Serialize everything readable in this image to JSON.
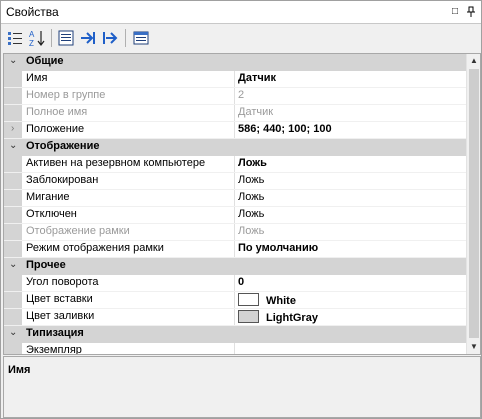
{
  "window": {
    "title": "Свойства",
    "restore_glyph": "□",
    "pin_glyph": "ᵾ"
  },
  "toolbar": {
    "icons": [
      "categorized-icon",
      "sort-az-icon",
      "properties-icon",
      "next-icon",
      "events-icon",
      "property-pages-icon"
    ]
  },
  "grid": {
    "categories": [
      {
        "label": "Общие",
        "expanded": true,
        "props": [
          {
            "name": "Имя",
            "value": "Датчик",
            "bold": true,
            "disabled": false
          },
          {
            "name": "Номер в группе",
            "value": "2",
            "bold": false,
            "disabled": true
          },
          {
            "name": "Полное имя",
            "value": "Датчик",
            "bold": false,
            "disabled": true
          },
          {
            "name": "Положение",
            "value": "586; 440; 100; 100",
            "bold": true,
            "disabled": false,
            "expandable": true
          }
        ]
      },
      {
        "label": "Отображение",
        "expanded": true,
        "props": [
          {
            "name": "Активен на резервном компьютере",
            "value": "Ложь",
            "bold": true,
            "disabled": false
          },
          {
            "name": "Заблокирован",
            "value": "Ложь",
            "bold": false,
            "disabled": false
          },
          {
            "name": "Мигание",
            "value": "Ложь",
            "bold": false,
            "disabled": false
          },
          {
            "name": "Отключен",
            "value": "Ложь",
            "bold": false,
            "disabled": false
          },
          {
            "name": "Отображение рамки",
            "value": "Ложь",
            "bold": false,
            "disabled": true
          },
          {
            "name": "Режим отображения рамки",
            "value": "По умолчанию",
            "bold": true,
            "disabled": false
          }
        ]
      },
      {
        "label": "Прочее",
        "expanded": true,
        "props": [
          {
            "name": "Угол поворота",
            "value": "0",
            "bold": true,
            "disabled": false
          },
          {
            "name": "Цвет вставки",
            "value": "White",
            "bold": true,
            "disabled": false,
            "swatch": "#ffffff"
          },
          {
            "name": "Цвет заливки",
            "value": "LightGray",
            "bold": true,
            "disabled": false,
            "swatch": "#d3d3d3"
          }
        ]
      },
      {
        "label": "Типизация",
        "expanded": true,
        "props": [
          {
            "name": "Экземпляр",
            "value": "",
            "bold": false,
            "disabled": false
          }
        ]
      }
    ]
  },
  "help": {
    "title": "Имя"
  },
  "colors": {
    "category_bg": "#d4d4d4",
    "disabled_text": "#9a9a9a",
    "accent_blue": "#1f5fc8"
  }
}
